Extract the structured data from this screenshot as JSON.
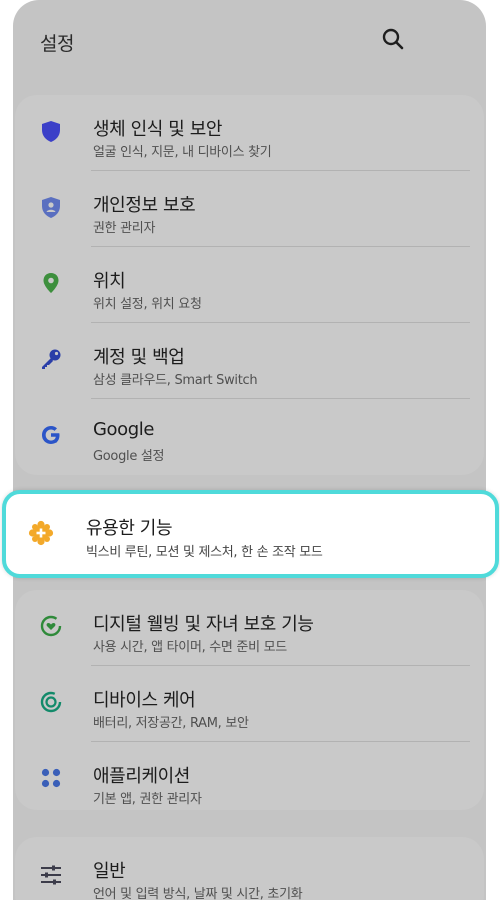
{
  "header": {
    "title": "설정",
    "search_icon": "search-icon"
  },
  "groups": [
    {
      "items": [
        {
          "title": "생체 인식 및 보안",
          "subtitle": "얼굴 인식, 지문, 내 디바이스 찾기",
          "icon": "shield-icon",
          "color": "#3b3fc8"
        },
        {
          "title": "개인정보 보호",
          "subtitle": "권한 관리자",
          "icon": "privacy-shield-icon",
          "color": "#5a6fc0"
        },
        {
          "title": "위치",
          "subtitle": "위치 설정, 위치 요청",
          "icon": "location-pin-icon",
          "color": "#3d8f3d"
        },
        {
          "title": "계정 및 백업",
          "subtitle": "삼성 클라우드, Smart Switch",
          "icon": "key-icon",
          "color": "#2a3ea8"
        },
        {
          "title": "Google",
          "subtitle": "Google 설정",
          "icon": "google-icon",
          "color": "#2b55c8"
        }
      ]
    },
    {
      "items": [
        {
          "title": "유용한 기능",
          "subtitle": "빅스비 루틴, 모션 및 제스처, 한 손 조작 모드",
          "icon": "puzzle-gear-icon",
          "color": "#f3a92a"
        }
      ]
    },
    {
      "items": [
        {
          "title": "디지털 웰빙 및 자녀 보호 기능",
          "subtitle": "사용 시간, 앱 타이머, 수면 준비 모드",
          "icon": "wellbeing-heart-icon",
          "color": "#2f8a3a"
        },
        {
          "title": "디바이스 케어",
          "subtitle": "배터리, 저장공간, RAM, 보안",
          "icon": "device-care-icon",
          "color": "#138a6a"
        },
        {
          "title": "애플리케이션",
          "subtitle": "기본 앱, 권한 관리자",
          "icon": "apps-grid-icon",
          "color": "#3a5fb8"
        }
      ]
    },
    {
      "items": [
        {
          "title": "일반",
          "subtitle": "언어 및 입력 방식, 날짜 및 시간, 초기화",
          "icon": "sliders-icon",
          "color": "#3c3c4a"
        }
      ]
    }
  ],
  "colors": {
    "dim_background": "#c4c4c4",
    "card": "#c9c9c9",
    "highlight_border": "#4fdada"
  }
}
